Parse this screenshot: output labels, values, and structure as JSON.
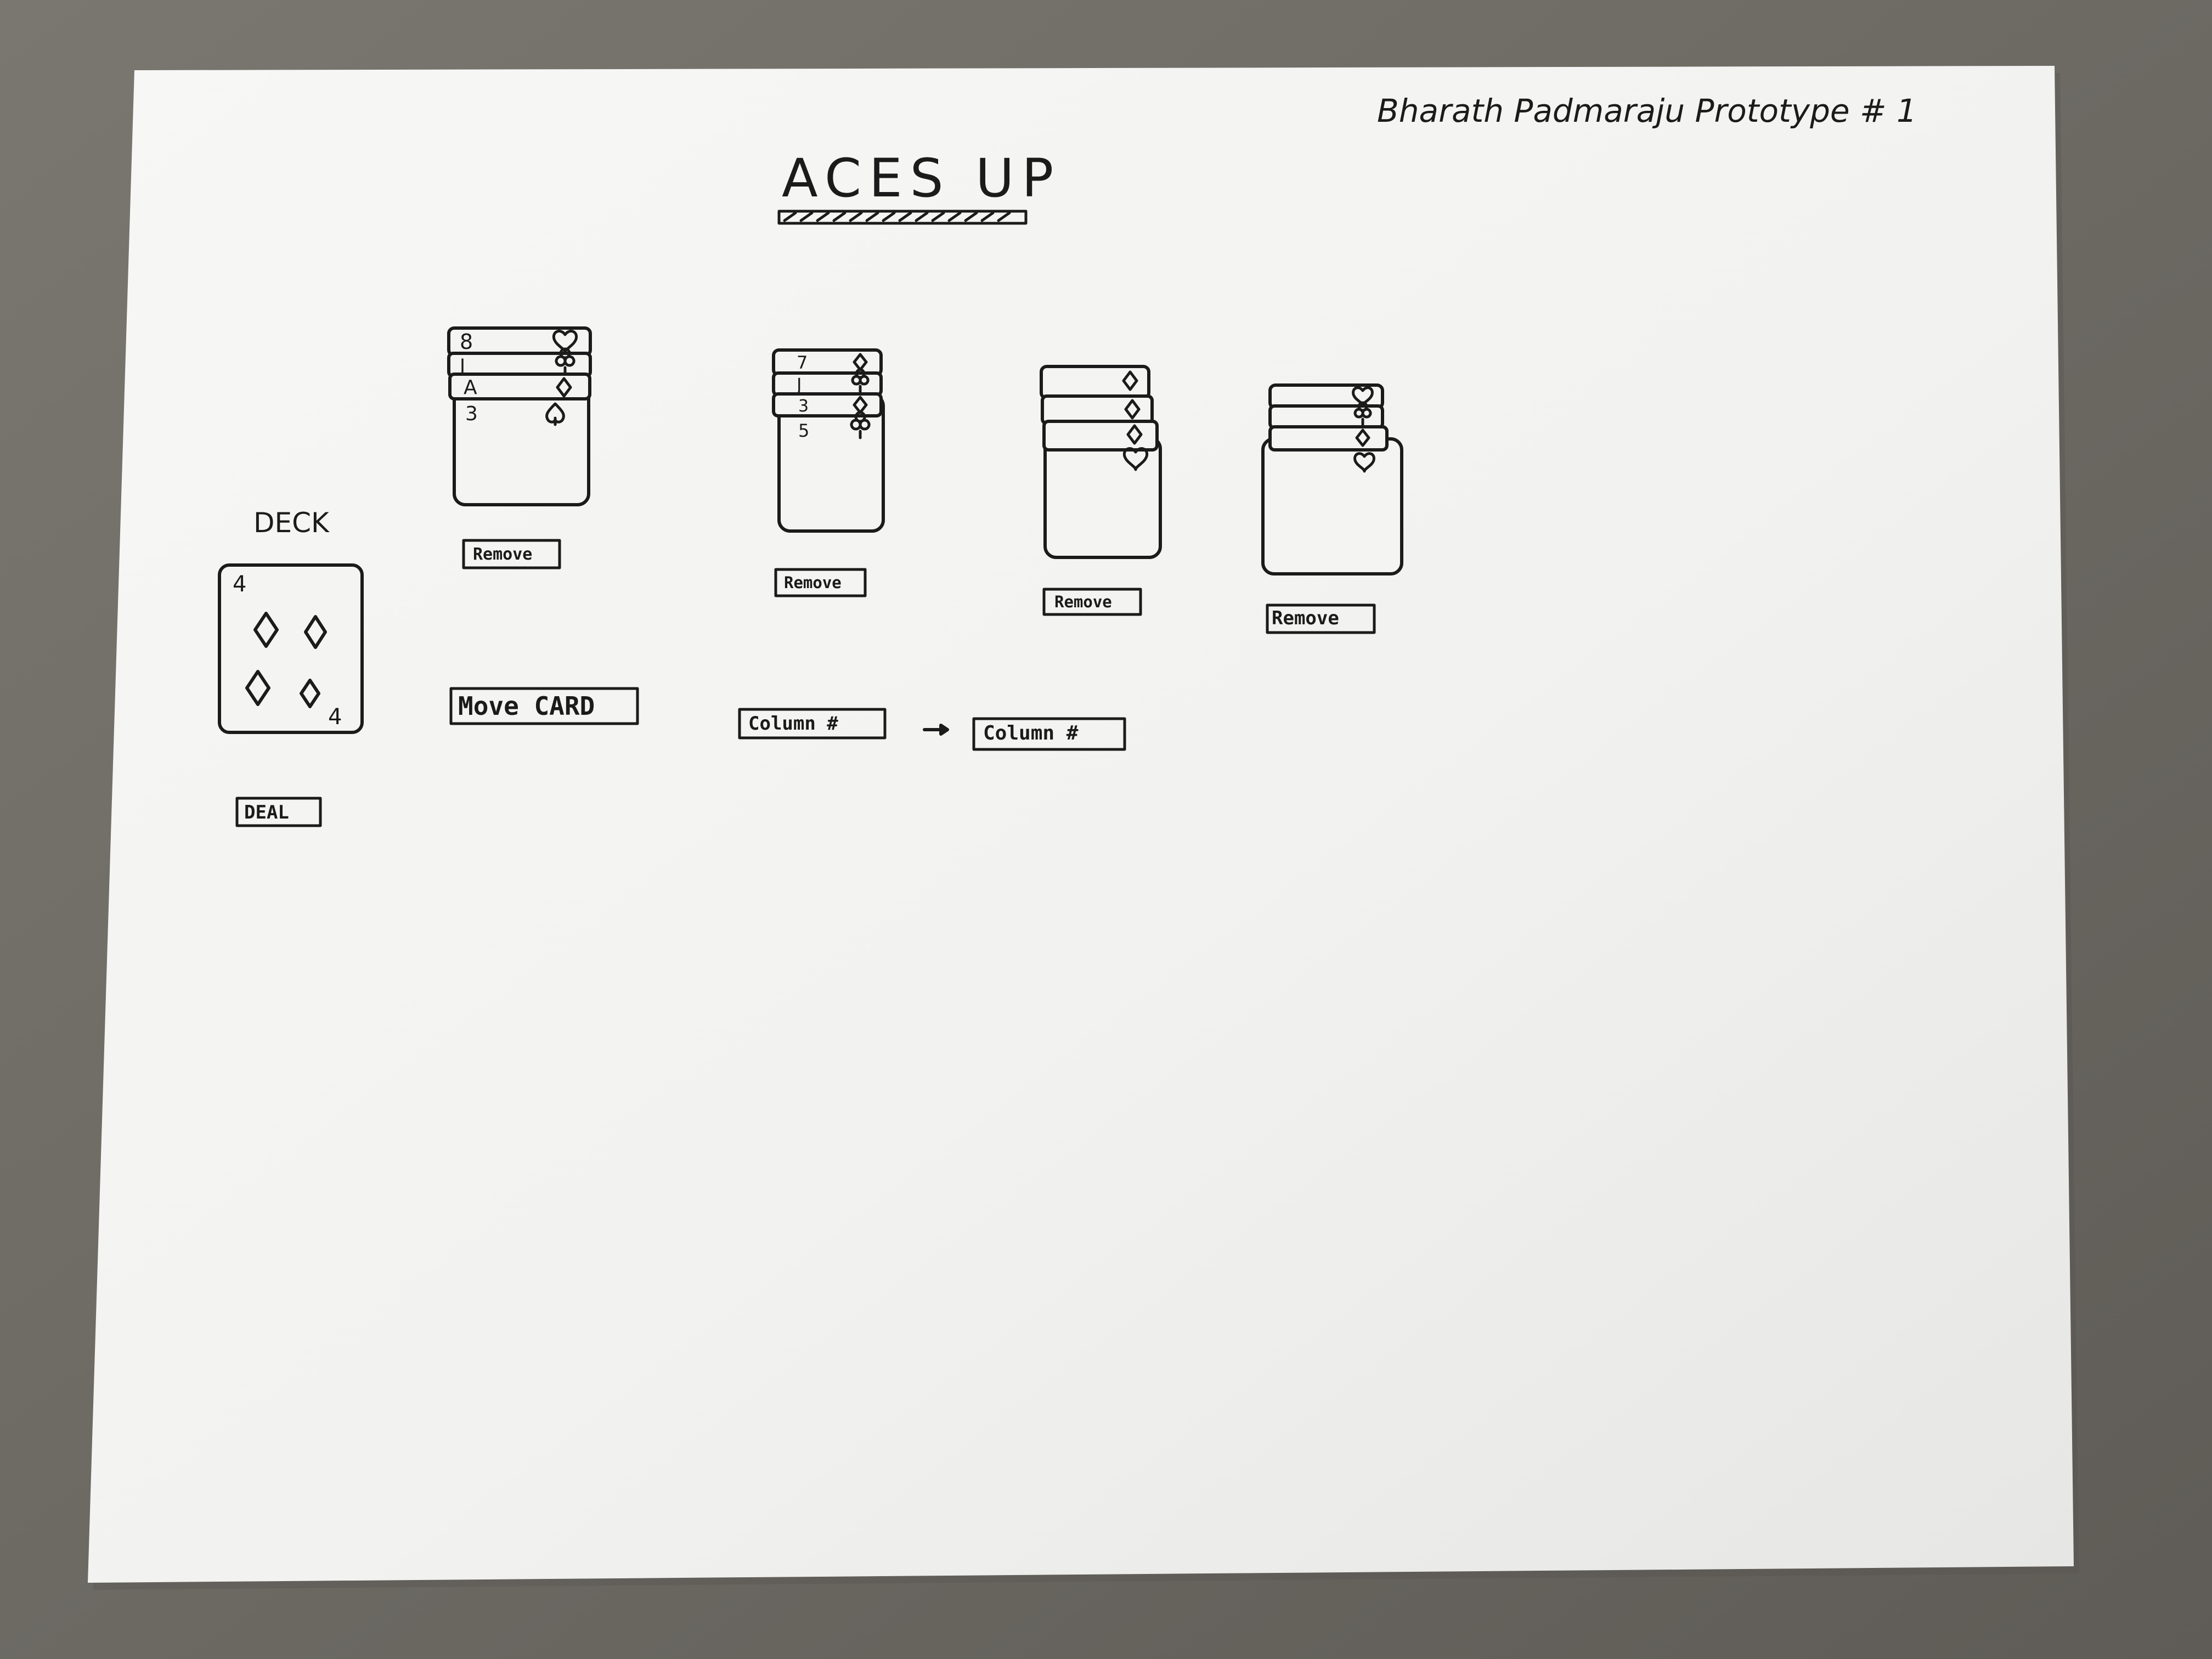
{
  "header": {
    "author_line": "Bharath Padmaraju Prototype # 1",
    "title": "ACES UP"
  },
  "deck": {
    "label": "DECK",
    "top_card": {
      "rank": "4",
      "suit_icon": "diamond-icon"
    },
    "deal_label": "DEAL"
  },
  "columns": [
    {
      "cards": [
        {
          "rank": "8",
          "suit_icon": "heart-icon"
        },
        {
          "rank": "J",
          "suit_icon": "club-icon"
        },
        {
          "rank": "A",
          "suit_icon": "diamond-icon"
        },
        {
          "rank": "3",
          "suit_icon": "spade-icon"
        }
      ],
      "remove_label": "Remove"
    },
    {
      "cards": [
        {
          "rank": "7",
          "suit_icon": "diamond-icon"
        },
        {
          "rank": "J",
          "suit_icon": "club-icon"
        },
        {
          "rank": "3",
          "suit_icon": "diamond-icon"
        },
        {
          "rank": "5",
          "suit_icon": "club-icon"
        }
      ],
      "remove_label": "Remove"
    },
    {
      "cards": [
        {
          "rank": "",
          "suit_icon": "diamond-icon"
        },
        {
          "rank": "",
          "suit_icon": "diamond-icon"
        },
        {
          "rank": "",
          "suit_icon": "diamond-icon"
        },
        {
          "rank": "",
          "suit_icon": "heart-icon"
        }
      ],
      "remove_label": "Remove"
    },
    {
      "cards": [
        {
          "rank": "",
          "suit_icon": "heart-icon"
        },
        {
          "rank": "",
          "suit_icon": "club-icon"
        },
        {
          "rank": "",
          "suit_icon": "diamond-icon"
        },
        {
          "rank": "",
          "suit_icon": "heart-icon"
        }
      ],
      "remove_label": "Remove"
    }
  ],
  "move": {
    "move_label": "Move CARD",
    "from_label": "Column #",
    "to_label": "Column #"
  },
  "colors": {
    "background": "#6f6c66",
    "paper": "#f4f4f2",
    "ink": "#1b1b1b"
  }
}
